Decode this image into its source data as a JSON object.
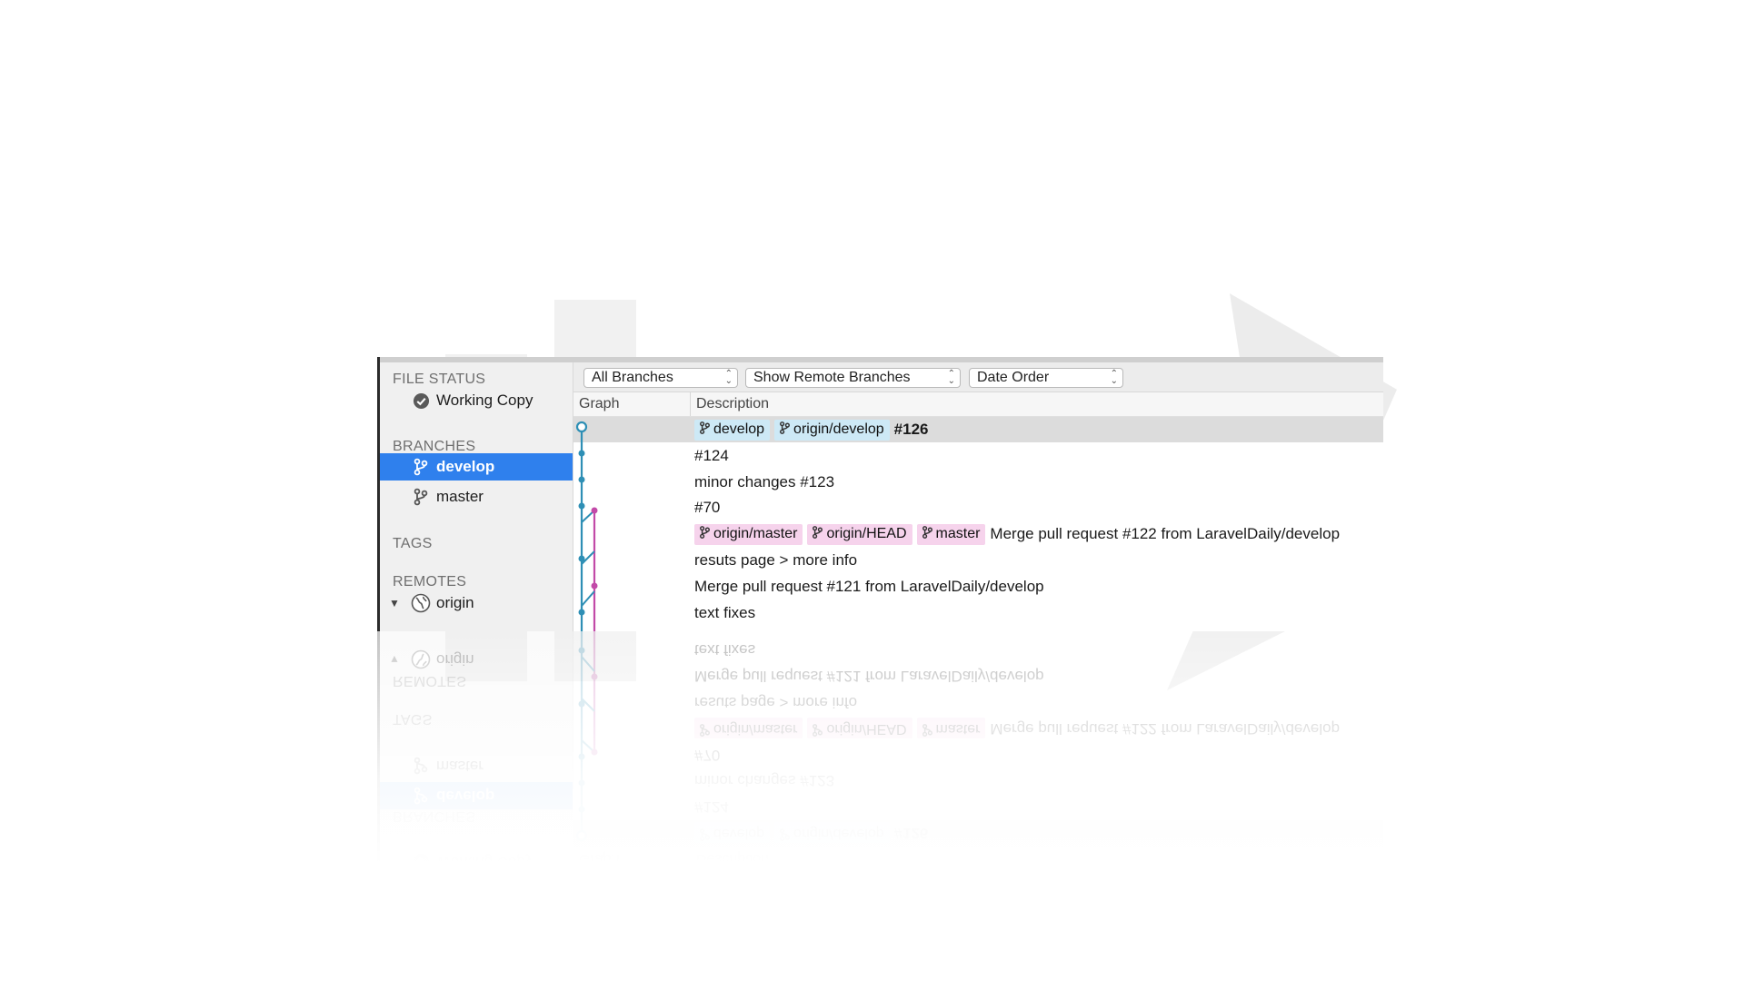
{
  "sidebar": {
    "file_status_title": "FILE STATUS",
    "working_copy": "Working Copy",
    "branches_title": "BRANCHES",
    "branches": [
      {
        "label": "develop",
        "selected": true
      },
      {
        "label": "master",
        "selected": false
      }
    ],
    "tags_title": "TAGS",
    "remotes_title": "REMOTES",
    "remote": "origin"
  },
  "toolbar": {
    "branches_filter": "All Branches",
    "remote_filter": "Show Remote Branches",
    "order": "Date Order"
  },
  "columns": {
    "graph": "Graph",
    "description": "Description"
  },
  "commits": [
    {
      "tags": [
        {
          "label": "develop",
          "color": "blue"
        },
        {
          "label": "origin/develop",
          "color": "blue"
        }
      ],
      "message": "#126",
      "bold": true
    },
    {
      "tags": [],
      "message": "#124"
    },
    {
      "tags": [],
      "message": "minor changes #123"
    },
    {
      "tags": [],
      "message": "#70"
    },
    {
      "tags": [
        {
          "label": "origin/master",
          "color": "pink"
        },
        {
          "label": "origin/HEAD",
          "color": "pink"
        },
        {
          "label": "master",
          "color": "pink"
        }
      ],
      "message": "Merge pull request #122 from LaravelDaily/develop"
    },
    {
      "tags": [],
      "message": "resuts page > more info"
    },
    {
      "tags": [],
      "message": "Merge pull request #121 from LaravelDaily/develop"
    },
    {
      "tags": [],
      "message": "text fixes"
    }
  ],
  "colors": {
    "selection": "#2f80ed",
    "branch_develop": "#2e8fb5",
    "branch_master": "#c24aa8",
    "tag_blue": "#cde9f6",
    "tag_pink": "#f6d3ec"
  }
}
